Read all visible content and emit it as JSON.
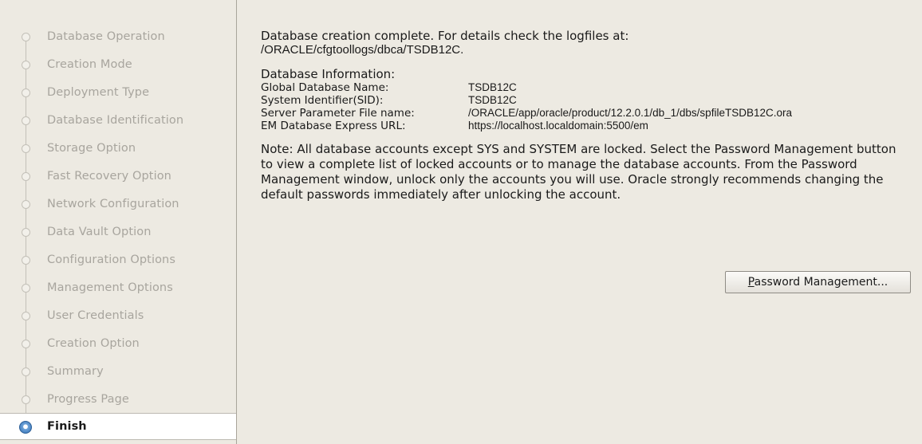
{
  "sidebar": {
    "steps": [
      {
        "label": "Database Operation"
      },
      {
        "label": "Creation Mode"
      },
      {
        "label": "Deployment Type"
      },
      {
        "label": "Database Identification"
      },
      {
        "label": "Storage Option"
      },
      {
        "label": "Fast Recovery Option"
      },
      {
        "label": "Network Configuration"
      },
      {
        "label": "Data Vault Option"
      },
      {
        "label": "Configuration Options"
      },
      {
        "label": "Management Options"
      },
      {
        "label": "User Credentials"
      },
      {
        "label": "Creation Option"
      },
      {
        "label": "Summary"
      },
      {
        "label": "Progress Page"
      },
      {
        "label": "Finish"
      }
    ],
    "active_step": "Finish"
  },
  "main": {
    "complete_message": "Database creation complete. For details check the logfiles at:",
    "log_path": " /ORACLE/cfgtoollogs/dbca/TSDB12C.",
    "info_heading": "Database Information:",
    "info_rows": [
      {
        "key": "Global Database Name:",
        "value": "TSDB12C"
      },
      {
        "key": "System Identifier(SID):",
        "value": "TSDB12C"
      },
      {
        "key": "Server Parameter File name:",
        "value": "/ORACLE/app/oracle/product/12.2.0.1/db_1/dbs/spfileTSDB12C.ora"
      },
      {
        "key": "EM Database Express URL:",
        "value": "https://localhost.localdomain:5500/em"
      }
    ],
    "note": "Note: All database accounts except SYS and SYSTEM are locked. Select the Password Management button to view a complete list of locked accounts or to manage the database accounts. From the Password Management window, unlock only the accounts you will use. Oracle strongly recommends changing the default passwords immediately after unlocking the account.",
    "password_button": {
      "mnemonic": "P",
      "rest": "assword Management..."
    }
  },
  "colors": {
    "background": "#edeae2",
    "active_node": "#2f6fb5",
    "inactive_text": "#a8a59e"
  }
}
